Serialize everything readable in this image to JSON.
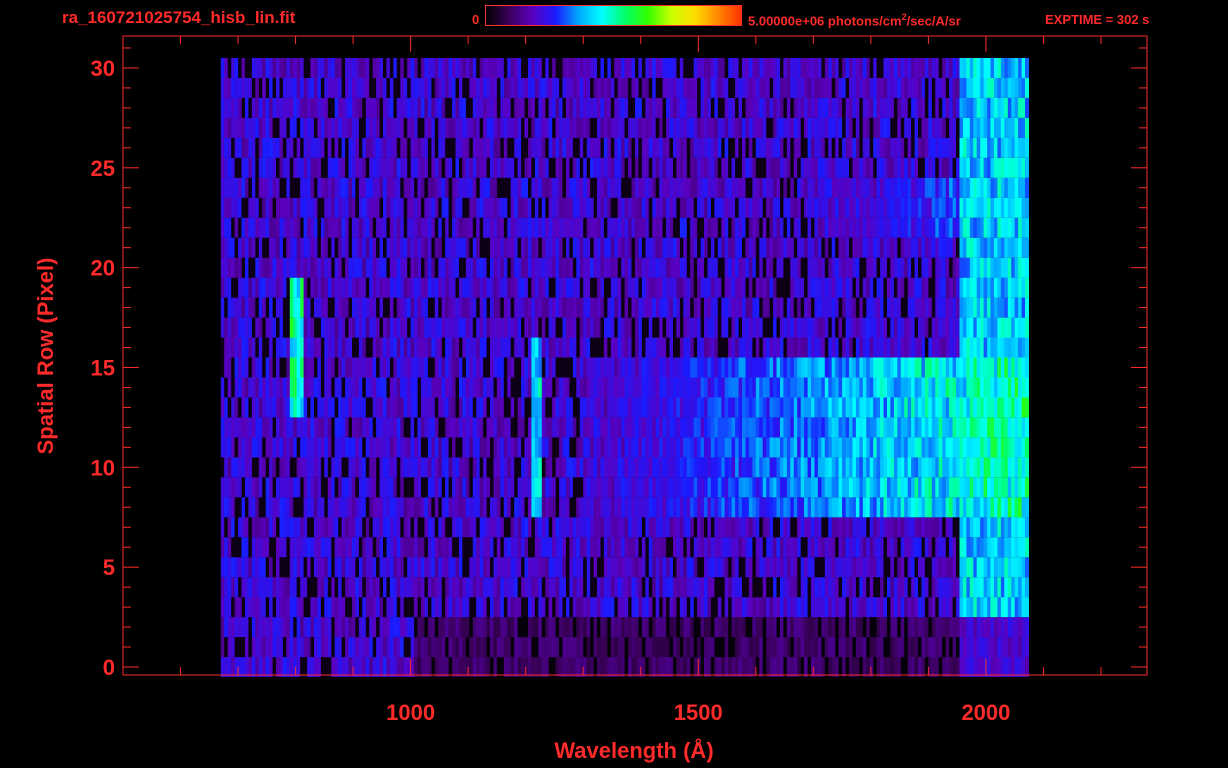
{
  "header": {
    "title": "ra_160721025754_hisb_lin.fit",
    "colorbar_min": "0",
    "colorbar_max_value": "5.00000e+06 photons/cm",
    "colorbar_max_exp": "2",
    "colorbar_max_unit": "/sec/A/sr",
    "exptime": "EXPTIME = 302 s"
  },
  "colors": {
    "axis": "#ff2a2a",
    "background": "#000000",
    "colormap": [
      "#000000",
      "#3a005a",
      "#5a00c0",
      "#1a1aff",
      "#00aaff",
      "#00ffff",
      "#00ff66",
      "#33ff00",
      "#ccff00",
      "#ffdd00",
      "#ff8800",
      "#ff3300"
    ]
  },
  "chart_data": {
    "type": "heatmap",
    "title": "ra_160721025754_hisb_lin.fit",
    "xlabel": "Wavelength (Å)",
    "ylabel": "Spatial Row (Pixel)",
    "xlim": [
      500,
      2280
    ],
    "ylim": [
      -0.4,
      31.6
    ],
    "xticks": [
      1000,
      1500,
      2000
    ],
    "xtick_labels": [
      "1000",
      "1500",
      "2000"
    ],
    "yticks": [
      0,
      5,
      10,
      15,
      20,
      25,
      30
    ],
    "ytick_labels": [
      "0",
      "5",
      "10",
      "15",
      "20",
      "25",
      "30"
    ],
    "colorbar_range": [
      0,
      5000000
    ],
    "colorbar_unit": "photons/cm^2/sec/A/sr",
    "exptime_s": 302,
    "signal_wavelength_range": [
      670,
      2070
    ],
    "rows": 31,
    "features": [
      {
        "name": "line",
        "x_range": [
          790,
          810
        ],
        "rows": [
          13,
          19
        ],
        "level": 0.5
      },
      {
        "name": "line",
        "x_range": [
          1205,
          1225
        ],
        "rows": [
          8,
          16
        ],
        "level": 0.42
      },
      {
        "name": "continuum",
        "x_range": [
          1300,
          2070
        ],
        "rows": [
          8,
          15
        ],
        "level": 0.5
      },
      {
        "name": "continuum",
        "x_range": [
          1700,
          2070
        ],
        "rows": [
          22,
          24
        ],
        "level": 0.38
      },
      {
        "name": "edge",
        "x_range": [
          1950,
          2070
        ],
        "rows": [
          0,
          30
        ],
        "level": 0.4
      }
    ]
  }
}
